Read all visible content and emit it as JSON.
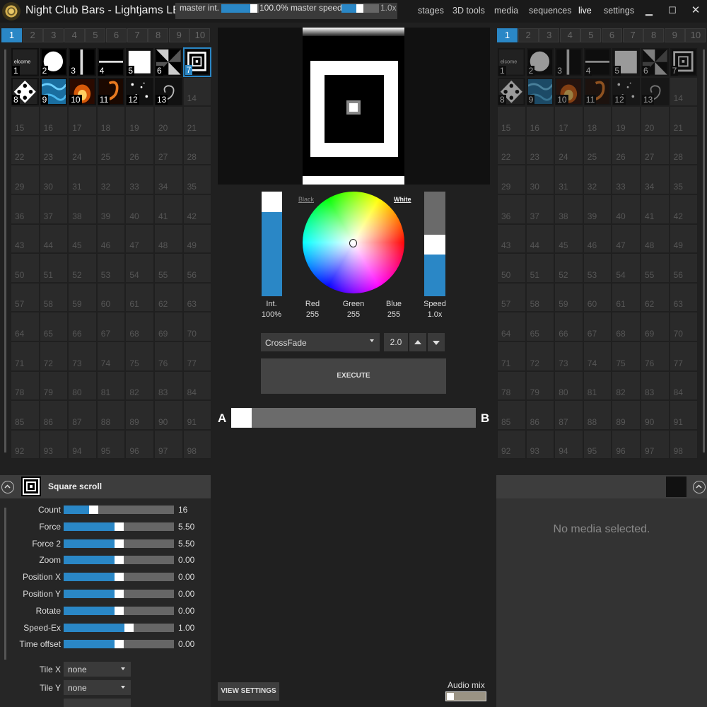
{
  "title_bar": {
    "app_title": "Night Club Bars - Lightjams LE...",
    "master_int_label": "master int.",
    "master_int_value": "100.0%",
    "master_int_fraction": 1.0,
    "master_speed_label": "master speed",
    "master_speed_value": "1.0x",
    "menu": [
      "stages",
      "3D tools",
      "media",
      "sequences",
      "live",
      "settings"
    ],
    "window_buttons": [
      "minimize-icon",
      "maximize-icon",
      "close-icon"
    ]
  },
  "left_pages": [
    "1",
    "2",
    "3",
    "4",
    "5",
    "6",
    "7",
    "8",
    "9",
    "10"
  ],
  "right_pages": [
    "1",
    "2",
    "3",
    "4",
    "5",
    "6",
    "7",
    "8",
    "9",
    "10"
  ],
  "active_page": "1",
  "left_grid": {
    "filled": [
      {
        "num": "1",
        "icon": "welcome-text-thumb",
        "text": "elcome"
      },
      {
        "num": "2",
        "icon": "white-circle-thumb"
      },
      {
        "num": "3",
        "icon": "vertical-line-thumb"
      },
      {
        "num": "4",
        "icon": "horizontal-line-thumb"
      },
      {
        "num": "5",
        "icon": "white-square-thumb"
      },
      {
        "num": "6",
        "icon": "radial-sweep-thumb"
      },
      {
        "num": "7",
        "icon": "square-scroll-thumb",
        "selected": true
      },
      {
        "num": "8",
        "icon": "diamond-pattern-thumb"
      },
      {
        "num": "9",
        "icon": "blue-water-thumb"
      },
      {
        "num": "10",
        "icon": "fire-thumb"
      },
      {
        "num": "11",
        "icon": "fire-swirl-thumb"
      },
      {
        "num": "12",
        "icon": "sparkle-thumb"
      },
      {
        "num": "13",
        "icon": "smoke-swirl-thumb"
      }
    ],
    "empty_start": 14,
    "empty_end": 98
  },
  "preview": {
    "label": "live-output-preview"
  },
  "color": {
    "black_label": "Black",
    "white_label": "White",
    "labels": [
      {
        "name": "Int.",
        "value": "100%"
      },
      {
        "name": "Red",
        "value": "255"
      },
      {
        "name": "Green",
        "value": "255"
      },
      {
        "name": "Blue",
        "value": "255"
      },
      {
        "name": "Speed",
        "value": "1.0x"
      }
    ],
    "intensity_fraction": 1.0
  },
  "transition": {
    "type": "CrossFade",
    "time": "2.0",
    "execute_label": "EXECUTE"
  },
  "crossfader": {
    "a_label": "A",
    "b_label": "B",
    "position_fraction": 0.0
  },
  "effect": {
    "title": "Square scroll",
    "params": [
      {
        "label": "Count",
        "value": "16",
        "fraction": 0.25
      },
      {
        "label": "Force",
        "value": "5.50",
        "fraction": 0.5
      },
      {
        "label": "Force 2",
        "value": "5.50",
        "fraction": 0.5
      },
      {
        "label": "Zoom",
        "value": "0.00",
        "fraction": 0.5
      },
      {
        "label": "Position X",
        "value": "0.00",
        "fraction": 0.5
      },
      {
        "label": "Position Y",
        "value": "0.00",
        "fraction": 0.5
      },
      {
        "label": "Rotate",
        "value": "0.00",
        "fraction": 0.5
      },
      {
        "label": "Speed-Ex",
        "value": "1.00",
        "fraction": 0.6
      },
      {
        "label": "Time offset",
        "value": "0.00",
        "fraction": 0.5
      }
    ],
    "selects": [
      {
        "label": "Tile X",
        "value": "none"
      },
      {
        "label": "Tile Y",
        "value": "none"
      }
    ]
  },
  "media": {
    "empty_text": "No media selected."
  },
  "footer": {
    "view_settings_label": "VIEW SETTINGS",
    "audio_mix_label": "Audio mix"
  },
  "colors": {
    "accent": "#2a87c6",
    "panel": "#2a2a2a",
    "background": "#202020"
  }
}
